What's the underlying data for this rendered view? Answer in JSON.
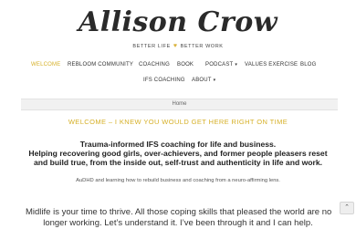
{
  "header": {
    "logo_text": "Allison Crow",
    "tagline_left": "BETTER LIFE",
    "tagline_icon": "heart-icon",
    "tagline_right": "BETTER WORK"
  },
  "nav": {
    "items": [
      {
        "label": "Welcome",
        "active": true
      },
      {
        "label": "Rebloom Community"
      },
      {
        "label": "Coaching"
      },
      {
        "label": "Book"
      },
      {
        "label": "Podcast",
        "has_dropdown": true
      },
      {
        "label": "Values Exercise"
      },
      {
        "label": "Blog"
      },
      {
        "label": "IFS Coaching"
      },
      {
        "label": "About",
        "has_dropdown": true
      }
    ],
    "caret_glyph": "▾"
  },
  "breadcrumb": {
    "text": "Home"
  },
  "main": {
    "welcome": "WELCOME – I KNEW YOU WOULD GET HERE RIGHT ON TIME",
    "lead_lines": [
      "Trauma-informed IFS coaching for life and business.",
      "Helping recovering good girls, over-achievers, and former people pleasers reset",
      "and build true, from the inside out, self-trust and authenticity in life and work."
    ],
    "subnote": "AuDHD and learning how to rebuild business and coaching from a neuro-affirming lens.",
    "body_lines": [
      "Midlife is your time to thrive. All those coping skills that pleased the world are no",
      "longer working. Let’s understand it. I’ve been through it and I can help."
    ]
  },
  "scroll_top": {
    "glyph": "⌃"
  },
  "colors": {
    "accent": "#d6b028",
    "text": "#222222",
    "breadcrumb_bg": "#f1f1f1"
  }
}
